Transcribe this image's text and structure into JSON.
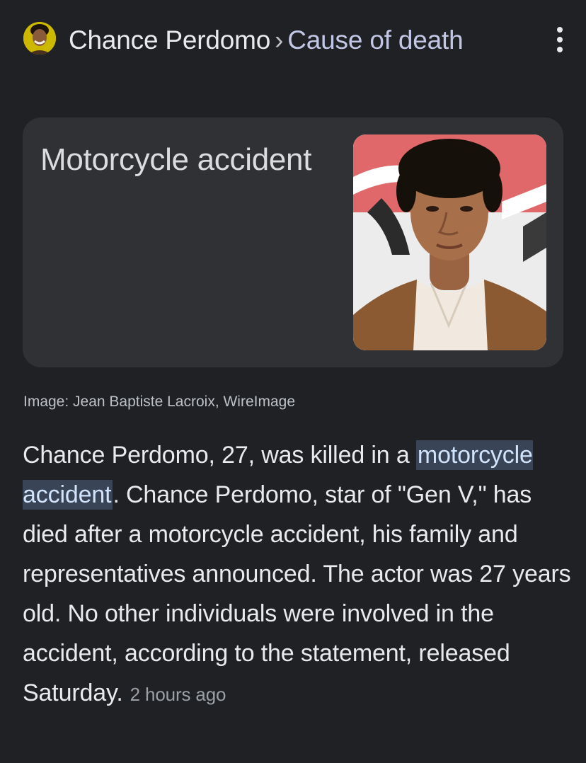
{
  "header": {
    "entity": "Chance Perdomo",
    "separator": "›",
    "topic": "Cause of death",
    "more_icon": "more-vertical-icon"
  },
  "answer_card": {
    "answer": "Motorcycle accident",
    "image_alt": "Chance Perdomo"
  },
  "caption": "Image: Jean Baptiste Lacroix, WireImage",
  "snippet": {
    "part1": "Chance Perdomo, 27, was killed in a ",
    "highlight": "motorcycle accident",
    "part2": ". Chance Perdomo, star of \"Gen V,\" has died after a motorcycle accident, his family and representatives announced. The actor was 27 years old. No other individuals were involved in the accident, according to the statement, released Saturday.",
    "timestamp": "2 hours ago"
  },
  "colors": {
    "background": "#202124",
    "card": "#303134",
    "highlight_bg": "#394457",
    "breadcrumb_topic": "#c3c7e6",
    "avatar_bg": "#c9b400",
    "photo_backdrop_red": "#e0686a"
  }
}
